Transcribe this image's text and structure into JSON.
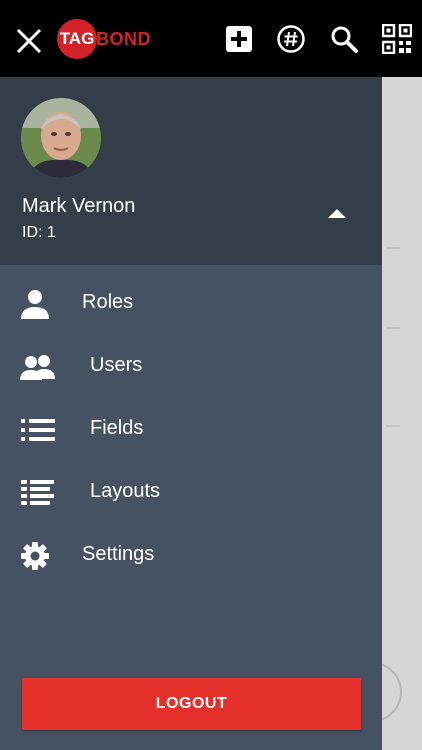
{
  "topbar": {
    "logo_tag": "TAG",
    "logo_bond": "BOND",
    "icons": [
      "close-icon",
      "add-icon",
      "hashtag-icon",
      "search-icon",
      "qr-code-icon"
    ]
  },
  "profile": {
    "name": "Mark Vernon",
    "id_text": "ID: 1"
  },
  "menu": {
    "items": [
      {
        "label": "Roles",
        "icon": "person-icon"
      },
      {
        "label": "Users",
        "icon": "people-icon"
      },
      {
        "label": "Fields",
        "icon": "list-icon"
      },
      {
        "label": "Layouts",
        "icon": "layout-list-icon"
      },
      {
        "label": "Settings",
        "icon": "gear-icon"
      }
    ]
  },
  "logout_label": "LOGOUT",
  "colors": {
    "topbar": "#000000",
    "brand_red": "#d2232a",
    "drawer": "#465162",
    "profile_bg": "#343d48",
    "logout": "#e3302a"
  }
}
